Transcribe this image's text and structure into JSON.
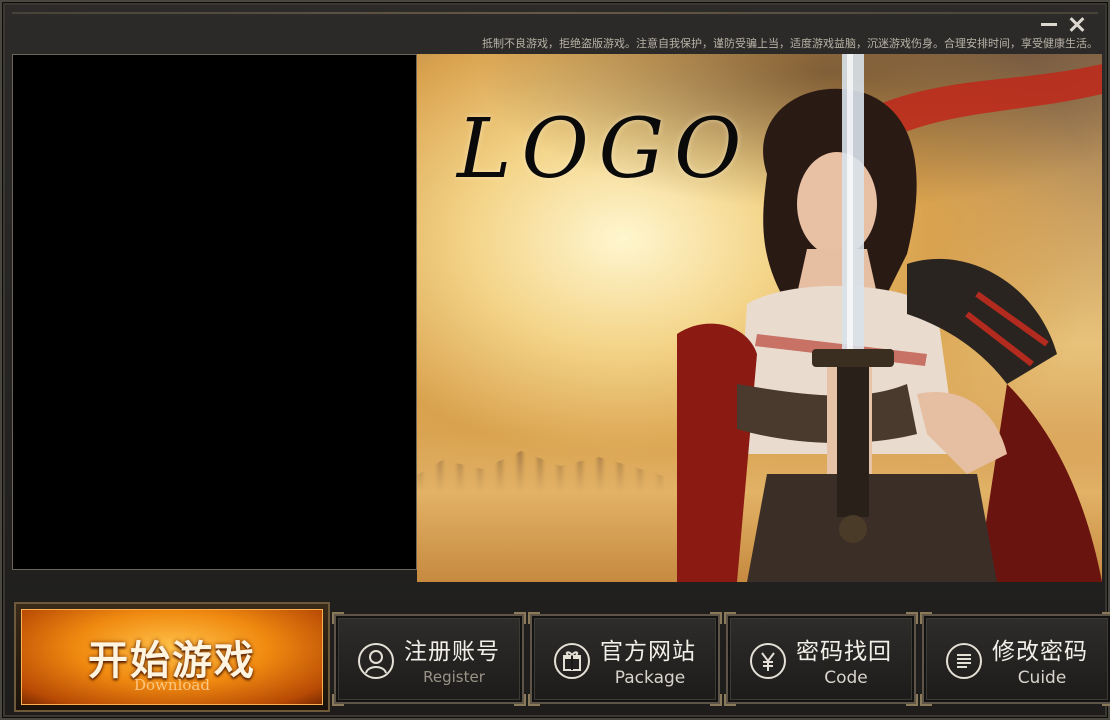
{
  "window": {
    "notice": "抵制不良游戏，拒绝盗版游戏。注意自我保护，谨防受骗上当，适度游戏益脑，沉迷游戏伤身。合理安排时间，享受健康生活。",
    "minimize_icon": "minimize-icon",
    "close_icon": "close-icon"
  },
  "banner": {
    "logo": "LOGO"
  },
  "start": {
    "title": "开始游戏",
    "subtitle": "Download"
  },
  "buttons": [
    {
      "title": "注册账号",
      "subtitle": "Register",
      "icon": "user-icon"
    },
    {
      "title": "官方网站",
      "subtitle": "Package",
      "icon": "gift-icon"
    },
    {
      "title": "密码找回",
      "subtitle": "Code",
      "icon": "yen-icon"
    },
    {
      "title": "修改密码",
      "subtitle": "Cuide",
      "icon": "document-icon"
    }
  ],
  "colors": {
    "frame": "#2c2b29",
    "accent_gold": "#8a7a5a",
    "start_orange": "#f08a10"
  }
}
